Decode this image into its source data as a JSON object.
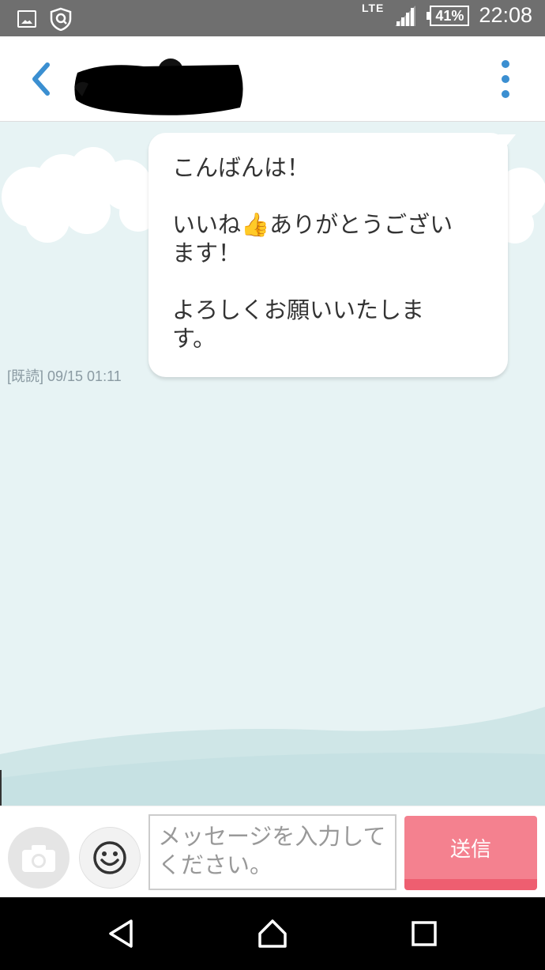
{
  "status_bar": {
    "network": "LTE",
    "battery": "41%",
    "time": "22:08",
    "icons": [
      "image-icon",
      "shield-icon",
      "signal-icon",
      "battery-icon"
    ]
  },
  "header": {
    "back_icon": "chevron-left-icon",
    "more_icon": "more-vertical-icon",
    "accent_color": "#3b8fd1"
  },
  "messages": [
    {
      "part1": "こんばんは！\n\nいいね",
      "emoji": "👍",
      "part2": "ありがとうござい\nます！\n\nよろしくお願いいたしま\nす。",
      "status": "[既読] 09/15 01:11"
    }
  ],
  "composer": {
    "placeholder": "メッセージを入力してください。",
    "send_label": "送信",
    "send_color": "#f4818f",
    "camera_icon": "camera-icon",
    "emoji_icon": "smiley-icon"
  },
  "nav": {
    "icons": [
      "back-triangle-icon",
      "home-icon",
      "recent-apps-icon"
    ]
  }
}
